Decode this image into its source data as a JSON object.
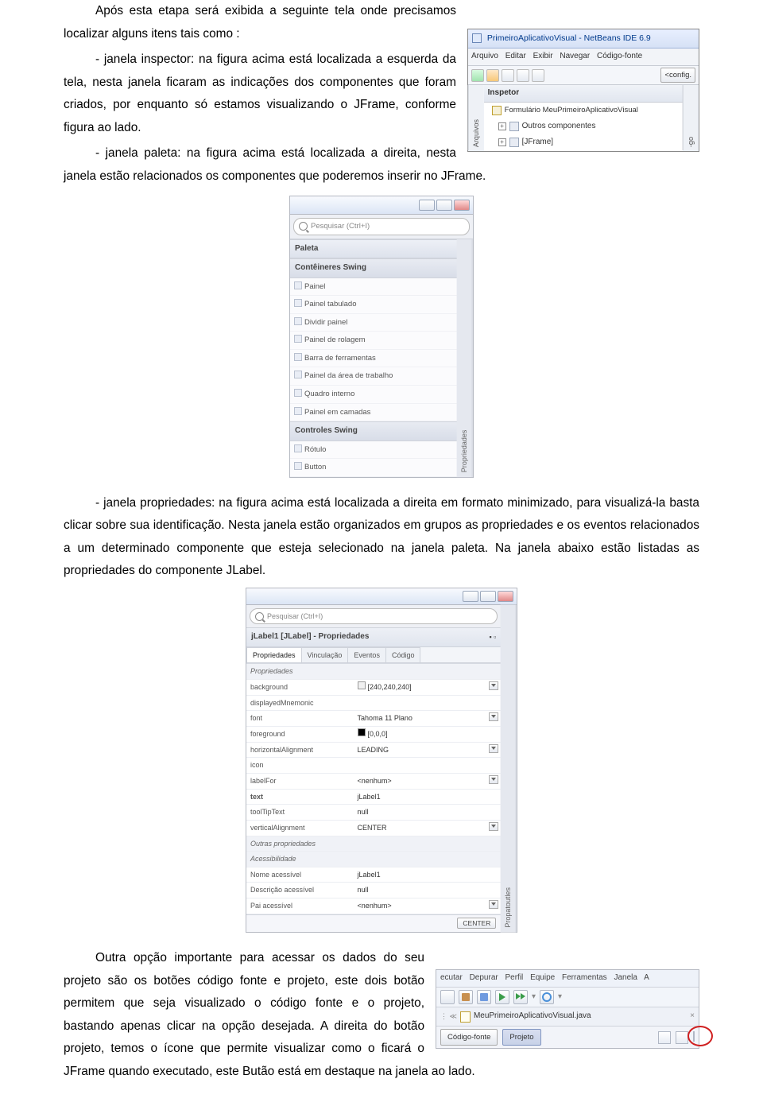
{
  "paragraphs": {
    "intro": "Após esta etapa será exibida a seguinte tela onde precisamos localizar alguns itens tais como :",
    "inspector": "- janela inspector: na figura acima está localizada a esquerda da tela, nesta janela ficaram as indicações dos componentes que foram criados, por enquanto só estamos visualizando o JFrame, conforme figura ao lado.",
    "paleta": "- janela paleta: na figura acima está localizada a direita, nesta janela estão relacionados os componentes que poderemos inserir no JFrame.",
    "propriedades": "- janela propriedades: na figura acima está localizada a direita em formato minimizado, para visualizá-la basta clicar sobre sua identificação. Nesta janela estão organizados em grupos as propriedades e os eventos relacionados a um determinado componente que esteja selecionado na janela paleta. Na janela abaixo estão listadas as propriedades do componente JLabel.",
    "final": "Outra opção importante para acessar os dados do seu projeto são os  botões código fonte e projeto, este dois botão permitem que seja visualizado o código fonte e o projeto, bastando apenas clicar na opção desejada. A direita do botão projeto, temos o ícone que permite visualizar como o ficará o JFrame quando executado, este Butão está em destaque na janela ao lado."
  },
  "inspector": {
    "title": "PrimeiroAplicativoVisual - NetBeans IDE 6.9",
    "menu": [
      "Arquivo",
      "Editar",
      "Exibir",
      "Navegar",
      "Código-fonte"
    ],
    "config_btn": "<config.",
    "vtabs": [
      "Arquivos",
      "-go"
    ],
    "panel_head": "Inspetor",
    "tree": [
      "Formulário MeuPrimeiroAplicativoVisual",
      "Outros componentes",
      "[JFrame]"
    ]
  },
  "paleta": {
    "search_placeholder": "Pesquisar (Ctrl+I)",
    "head1": "Paleta",
    "head2": "Contêineres Swing",
    "items1": [
      "Painel",
      "Painel tabulado",
      "Dividir painel",
      "Painel de rolagem",
      "Barra de ferramentas",
      "Painel da área de trabalho",
      "Quadro interno",
      "Painel em camadas"
    ],
    "head3": "Controles Swing",
    "items2": [
      "Rótulo",
      "Button"
    ],
    "vtab": "Propriedades"
  },
  "props": {
    "search_placeholder": "Pesquisar (Ctrl+I)",
    "title": "jLabel1 [JLabel] - Propriedades",
    "tabs": [
      "Propriedades",
      "Vinculação",
      "Eventos",
      "Código"
    ],
    "rows_head": "Propriedades",
    "rows": [
      {
        "k": "background",
        "v": "[240,240,240]"
      },
      {
        "k": "displayedMnemonic",
        "v": ""
      },
      {
        "k": "font",
        "v": "Tahoma 11 Plano"
      },
      {
        "k": "foreground",
        "v": "[0,0,0]"
      },
      {
        "k": "horizontalAlignment",
        "v": "LEADING"
      },
      {
        "k": "icon",
        "v": ""
      },
      {
        "k": "labelFor",
        "v": "<nenhum>"
      },
      {
        "k": "text",
        "v": "jLabel1"
      },
      {
        "k": "toolTipText",
        "v": "null"
      },
      {
        "k": "verticalAlignment",
        "v": "CENTER"
      }
    ],
    "sub_head": "Outras propriedades",
    "sub_head2": "Acessibilidade",
    "rows2": [
      {
        "k": "Nome acessível",
        "v": "jLabel1"
      },
      {
        "k": "Descrição acessível",
        "v": "null"
      },
      {
        "k": "Pai acessível",
        "v": "<nenhum>"
      }
    ],
    "center_btn": "CENTER",
    "vtab": "Propatoutles"
  },
  "toolbar": {
    "menu": [
      "ecutar",
      "Depurar",
      "Perfil",
      "Equipe",
      "Ferramentas",
      "Janela",
      "A"
    ],
    "filetab": "MeuPrimeiroAplicativoVisual.java",
    "btn_fonte": "Código-fonte",
    "btn_projeto": "Projeto"
  }
}
